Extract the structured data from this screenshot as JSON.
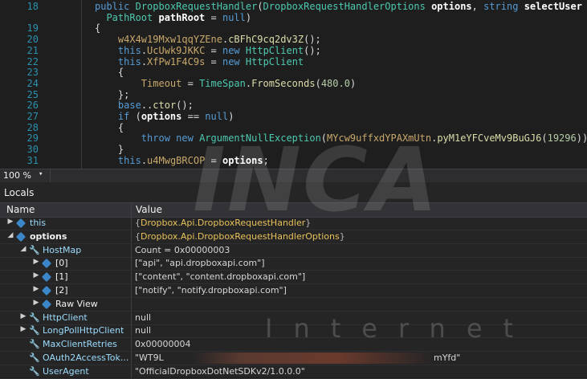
{
  "editor": {
    "lines": [
      {
        "num": "18",
        "html": "<span class='kw'>public</span> <span class='ty'>DropboxRequestHandler</span>(<span class='ty'>DropboxRequestHandlerOptions</span> <span class='bo'>options</span>, <span class='kw'>string</span> <span class='bo'>selectUser</span> = <span class='kw'>null</span>,"
      },
      {
        "num": "",
        "html": "  <span class='ty'>PathRoot</span> <span class='bo'>pathRoot</span> = <span class='kw'>null</span>)"
      },
      {
        "num": "19",
        "html": "{"
      },
      {
        "num": "20",
        "html": "    <span class='ob'>w4X4w19Mxw1qqYZEne</span>.<span class='fn'>cBFhC9cq2dv3Z</span>();"
      },
      {
        "num": "21",
        "html": "    <span class='kw'>this</span>.<span class='ob'>UcUwk9JKKC</span> = <span class='kw'>new</span> <span class='ty'>HttpClient</span>();"
      },
      {
        "num": "22",
        "html": "    <span class='kw'>this</span>.<span class='ob'>XfPw1F4C9s</span> = <span class='kw'>new</span> <span class='ty'>HttpClient</span>"
      },
      {
        "num": "23",
        "html": "    {"
      },
      {
        "num": "24",
        "html": "        <span class='ob'>Timeout</span> = <span class='ty'>TimeSpan</span>.<span class='fn'>FromSeconds</span>(<span class='nu'>480.0</span>)"
      },
      {
        "num": "25",
        "html": "    };"
      },
      {
        "num": "26",
        "html": "    <span class='kw'>base</span>..<span class='fn'>ctor</span>();"
      },
      {
        "num": "27",
        "html": "    <span class='kw'>if</span> (<span class='bo'>options</span> == <span class='kw'>null</span>)"
      },
      {
        "num": "28",
        "html": "    {"
      },
      {
        "num": "29",
        "html": "        <span class='kw'>throw</span> <span class='kw'>new</span> <span class='ty'>ArgumentNullException</span>(<span class='ob'>MYcw9uffxdYPAXmUtn</span>.<span class='fn'>pyM1eYFCveMv9BuGJ6</span>(<span class='nu'>19296</span>));"
      },
      {
        "num": "30",
        "html": "    }"
      },
      {
        "num": "31",
        "html": "    <span class='kw'>this</span>.<span class='ob'>u4MwgBRCOP</span> = <span class='bo'>options</span>;"
      }
    ]
  },
  "zoom": {
    "value": "100 %",
    "arrow": "▾"
  },
  "locals": {
    "title": "Locals",
    "col_name": "Name",
    "col_value": "Value",
    "rows": [
      {
        "expander": "▶",
        "icon": "cube",
        "name": "this",
        "value_pre": "{",
        "value_obj": "Dropbox.Api.DropboxRequestHandler",
        "value_post": "}",
        "bold": false
      },
      {
        "expander": "◢",
        "icon": "cube",
        "name": "options",
        "value_pre": "{",
        "value_obj": "Dropbox.Api.DropboxRequestHandlerOptions",
        "value_post": "}",
        "bold": true
      },
      {
        "expander": "◢",
        "icon": "wrench",
        "name": "HostMap",
        "value": "Count = 0x00000003"
      },
      {
        "expander": "▶",
        "icon": "cube",
        "name": "[0]",
        "value": "[\"api\", \"api.dropboxapi.com\"]",
        "white": true
      },
      {
        "expander": "▶",
        "icon": "cube",
        "name": "[1]",
        "value": "[\"content\", \"content.dropboxapi.com\"]",
        "white": true
      },
      {
        "expander": "▶",
        "icon": "cube",
        "name": "[2]",
        "value": "[\"notify\", \"notify.dropboxapi.com\"]",
        "white": true
      },
      {
        "expander": "▶",
        "icon": "cube",
        "name": "Raw View",
        "value": "",
        "white": true
      },
      {
        "expander": "▶",
        "icon": "wrench",
        "name": "HttpClient",
        "value": "null"
      },
      {
        "expander": "▶",
        "icon": "wrench",
        "name": "LongPollHttpClient",
        "value": "null"
      },
      {
        "expander": "",
        "icon": "wrench",
        "name": "MaxClientRetries",
        "value": "0x00000004"
      },
      {
        "expander": "",
        "icon": "wrench",
        "name": "OAuth2AccessTok...",
        "value_start": "\"WT9L",
        "value_end": "mYfd\"",
        "redacted": true
      },
      {
        "expander": "",
        "icon": "wrench",
        "name": "UserAgent",
        "value": "\"OfficialDropboxDotNetSDKv2/1.0.0.0\""
      }
    ]
  },
  "watermark": {
    "logo": "INCA",
    "sub": "Internet"
  }
}
